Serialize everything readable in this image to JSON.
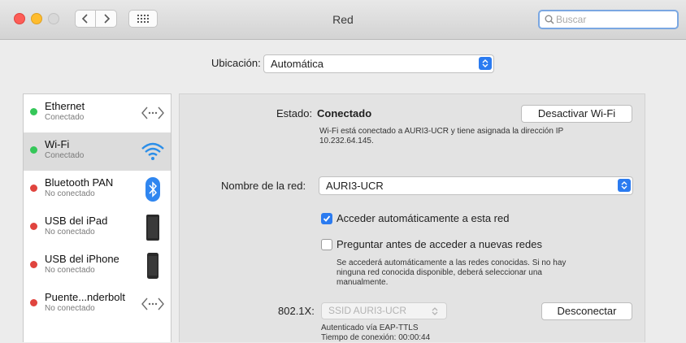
{
  "window": {
    "title": "Red"
  },
  "search": {
    "placeholder": "Buscar"
  },
  "location": {
    "label": "Ubicación:",
    "value": "Automática"
  },
  "services": [
    {
      "name": "Ethernet",
      "status": "Conectado",
      "connected": true,
      "icon": "arrows-icon"
    },
    {
      "name": "Wi-Fi",
      "status": "Conectado",
      "connected": true,
      "icon": "wifi-icon"
    },
    {
      "name": "Bluetooth PAN",
      "status": "No conectado",
      "connected": false,
      "icon": "bluetooth-icon"
    },
    {
      "name": "USB del iPad",
      "status": "No conectado",
      "connected": false,
      "icon": "ipad-icon"
    },
    {
      "name": "USB del iPhone",
      "status": "No conectado",
      "connected": false,
      "icon": "iphone-icon"
    },
    {
      "name": "Puente...nderbolt",
      "status": "No conectado",
      "connected": false,
      "icon": "arrows-icon"
    }
  ],
  "detail": {
    "status_label": "Estado:",
    "status_value": "Conectado",
    "toggle_button": "Desactivar Wi-Fi",
    "status_desc_line1": "Wi-Fi está conectado a AURI3-UCR y tiene asignada la dirección IP",
    "status_desc_line2": "10.232.64.145.",
    "network_label": "Nombre de la red:",
    "network_value": "AURI3-UCR",
    "auto_join_label": "Acceder automáticamente a esta red",
    "auto_join_checked": true,
    "ask_join_label": "Preguntar antes de acceder a nuevas redes",
    "ask_join_checked": false,
    "ask_desc_line1": "Se accederá automáticamente a las redes conocidas. Si no hay",
    "ask_desc_line2": "ninguna red conocida disponible, deberá seleccionar una",
    "ask_desc_line3": "manualmente.",
    "dot1x_label": "802.1X:",
    "dot1x_value": "SSID AURI3-UCR",
    "disconnect_button": "Desconectar",
    "auth_line": "Autenticado vía EAP-TTLS",
    "conn_time_line": "Tiempo de conexión: 00:00:44"
  },
  "colors": {
    "accent": "#2b7bf0",
    "connected": "#35c759",
    "disconnected": "#e0443e"
  }
}
